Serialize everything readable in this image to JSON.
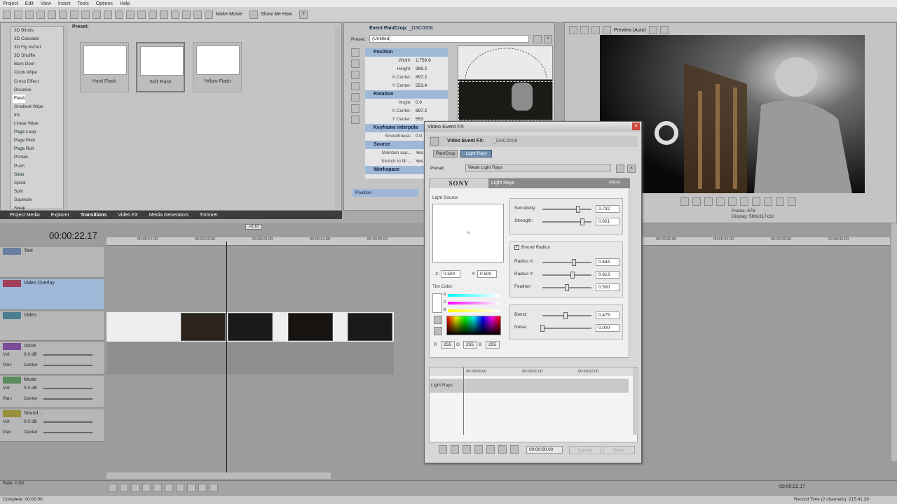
{
  "menu": [
    "Project",
    "Edit",
    "View",
    "Insert",
    "Tools",
    "Options",
    "Help"
  ],
  "toolbar": {
    "make_movie": "Make Movie",
    "show_me_how": "Show Me How"
  },
  "transitions": {
    "list": [
      "3D Blinds",
      "3D Cascade",
      "3D Fly In/Out",
      "3D Shuffle",
      "Barn Door",
      "Clock Wipe",
      "Cross Effect",
      "Dissolve",
      "Flash",
      "Gradient Wipe",
      "Iris",
      "Linear Wipe",
      "Page Loop",
      "Page Peel",
      "Page Roll",
      "Portals",
      "Push",
      "Slide",
      "Spiral",
      "Split",
      "Squeeze",
      "Swap"
    ],
    "selected_index": 8,
    "preset_label": "Preset:",
    "presets": [
      "Hard Flash",
      "Soft Flash",
      "Yellow Flash"
    ]
  },
  "bottom_tabs": [
    "Project Media",
    "Explorer",
    "Transitions",
    "Video FX",
    "Media Generators",
    "Trimmer"
  ],
  "pancrop": {
    "title": "Event Pan/Crop:",
    "file": "_DSC0008",
    "preset_label": "Preset:",
    "preset_value": "(Untitled)",
    "sections": [
      {
        "name": "Position",
        "rows": [
          [
            "Width:",
            "1,758.6"
          ],
          [
            "Height:",
            "989.2"
          ],
          [
            "X Center:",
            "897.2"
          ],
          [
            "Y Center:",
            "553.4"
          ]
        ]
      },
      {
        "name": "Rotation",
        "rows": [
          [
            "Angle:",
            "0.0"
          ],
          [
            "X Center:",
            "897.2"
          ],
          [
            "Y Center:",
            "553"
          ]
        ]
      },
      {
        "name": "Keyframe interpola",
        "rows": [
          [
            "Smoothness:",
            "0.0"
          ]
        ]
      },
      {
        "name": "Source",
        "rows": [
          [
            "Maintain asp...",
            "Yes"
          ],
          [
            "Stretch to fill ...",
            "Yes"
          ]
        ]
      },
      {
        "name": "Workspace",
        "rows": []
      }
    ],
    "position_tab": "Position"
  },
  "preview": {
    "label": "Preview (Auto)",
    "frame_label": "Frame:",
    "frame_value": "676",
    "display_label": "Display:",
    "display_value": "569x317x32"
  },
  "timeline": {
    "timecode": "00:00:22.17",
    "marker": "+6:10",
    "ticks": [
      "00:00:21.00",
      "00:00:22.00",
      "00:00:23.00",
      "00:00:24.00",
      "00:00:25.00",
      "00:00:30.00",
      "00:00:31.00",
      "00:00:32.00",
      "00:00:33.00"
    ],
    "tracks": [
      {
        "name": "Text",
        "color": "#6a7ea0"
      },
      {
        "name": "Video Overlay",
        "color": "#a0405a"
      },
      {
        "name": "Video",
        "color": "#4b7f8f"
      },
      {
        "name": "Voice",
        "color": "#7a4c9a",
        "vol": "0.0 dB",
        "pan": "Center"
      },
      {
        "name": "Music",
        "color": "#5c8c5c",
        "vol": "0.0 dB",
        "pan": "Center"
      },
      {
        "name": "Sound...",
        "color": "#9a8f3c",
        "vol": "0.0 dB",
        "pan": "Center"
      }
    ],
    "vol_label": "Vol:",
    "pan_label": "Pan:",
    "rate": "Rate: 0.00",
    "end_time": "00:00:22.17",
    "complete": "Complete: 00:00:00",
    "record_time": "Record Time (2 channels): 215:41:20"
  },
  "dialog": {
    "title": "Video Event FX",
    "fx_title": "Video Event FX:",
    "file": "_DSC0008",
    "chain": [
      "Pan/Crop",
      "Light Rays"
    ],
    "preset_label": "Preset:",
    "preset_value": "Weak Light Rays",
    "brand": "SONY",
    "plugin": "Light Rays",
    "about": "About",
    "light_source": "Light Source",
    "center_mark": "In",
    "x_label": "X:",
    "x_value": "0.500",
    "y_label": "Y:",
    "y_value": "0.500",
    "tint_label": "Tint Color:",
    "r_label": "R",
    "g_label": "G",
    "b_label": "B",
    "r_value": "255",
    "g_value": "255",
    "b_value": "255",
    "params": [
      {
        "label": "Sensitivity:",
        "value": "0.732",
        "level": 0.732
      },
      {
        "label": "Strength:",
        "value": "0.821",
        "level": 0.821
      }
    ],
    "bound_radius": "Bound Radius",
    "radius_params": [
      {
        "label": "Radius X:",
        "value": "0.644",
        "level": 0.644
      },
      {
        "label": "Radius Y:",
        "value": "0.613",
        "level": 0.613
      },
      {
        "label": "Feather:",
        "value": "0.500",
        "level": 0.5
      }
    ],
    "blend_params": [
      {
        "label": "Blend:",
        "value": "0.475",
        "level": 0.475
      },
      {
        "label": "Noise:",
        "value": "0.000",
        "level": 0.0
      }
    ],
    "kf_ticks": [
      "00:00:00.00",
      "00:00:01.00",
      "00:00:02.00"
    ],
    "kf_track": "Light Rays",
    "time_value": "00:00:00.00",
    "cancel": "Cancel",
    "close": "Close"
  }
}
